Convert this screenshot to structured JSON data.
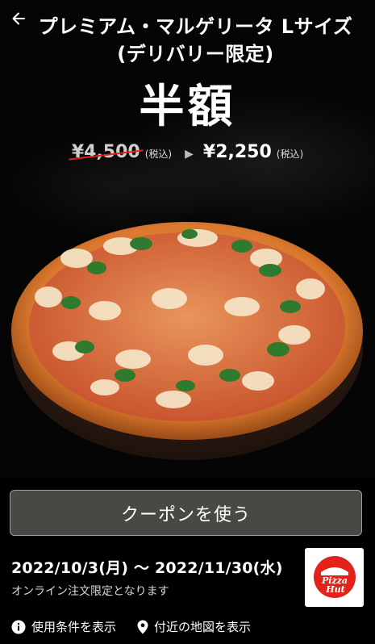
{
  "header": {
    "title_line1": "プレミアム・マルゲリータ Lサイズ",
    "title_line2": "(デリバリー限定)",
    "back_icon": "arrow-left-icon"
  },
  "promo": {
    "headline": "半額",
    "old_price": "¥4,500",
    "old_tax": "(税込)",
    "new_price": "¥2,250",
    "new_tax": "(税込)"
  },
  "coupon_button_label": "クーポンを使う",
  "period": "2022/10/3(月) 〜 2022/11/30(水)",
  "note": "オンライン注文限定となります",
  "brand": {
    "logo_text_1": "Pizza",
    "logo_text_2": "Hut"
  },
  "links": {
    "terms": "使用条件を表示",
    "map": "付近の地図を表示"
  },
  "colors": {
    "background": "#000000",
    "button_bg": "#4a4845",
    "strike": "#e2231a",
    "brand_red": "#e2231a"
  }
}
